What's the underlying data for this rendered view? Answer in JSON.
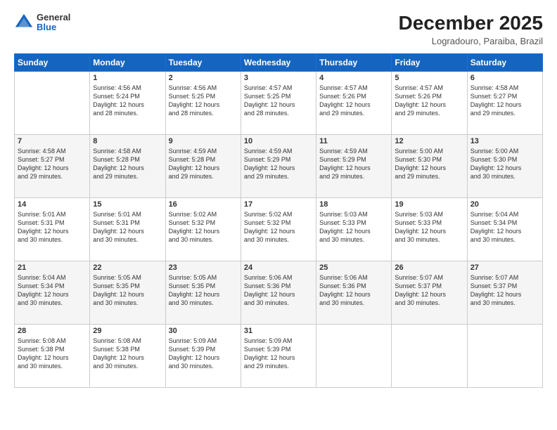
{
  "header": {
    "logo_general": "General",
    "logo_blue": "Blue",
    "month_title": "December 2025",
    "subtitle": "Logradouro, Paraiba, Brazil"
  },
  "days_of_week": [
    "Sunday",
    "Monday",
    "Tuesday",
    "Wednesday",
    "Thursday",
    "Friday",
    "Saturday"
  ],
  "weeks": [
    [
      {
        "day": "",
        "info": ""
      },
      {
        "day": "1",
        "info": "Sunrise: 4:56 AM\nSunset: 5:24 PM\nDaylight: 12 hours\nand 28 minutes."
      },
      {
        "day": "2",
        "info": "Sunrise: 4:56 AM\nSunset: 5:25 PM\nDaylight: 12 hours\nand 28 minutes."
      },
      {
        "day": "3",
        "info": "Sunrise: 4:57 AM\nSunset: 5:25 PM\nDaylight: 12 hours\nand 28 minutes."
      },
      {
        "day": "4",
        "info": "Sunrise: 4:57 AM\nSunset: 5:26 PM\nDaylight: 12 hours\nand 29 minutes."
      },
      {
        "day": "5",
        "info": "Sunrise: 4:57 AM\nSunset: 5:26 PM\nDaylight: 12 hours\nand 29 minutes."
      },
      {
        "day": "6",
        "info": "Sunrise: 4:58 AM\nSunset: 5:27 PM\nDaylight: 12 hours\nand 29 minutes."
      }
    ],
    [
      {
        "day": "7",
        "info": "Sunrise: 4:58 AM\nSunset: 5:27 PM\nDaylight: 12 hours\nand 29 minutes."
      },
      {
        "day": "8",
        "info": "Sunrise: 4:58 AM\nSunset: 5:28 PM\nDaylight: 12 hours\nand 29 minutes."
      },
      {
        "day": "9",
        "info": "Sunrise: 4:59 AM\nSunset: 5:28 PM\nDaylight: 12 hours\nand 29 minutes."
      },
      {
        "day": "10",
        "info": "Sunrise: 4:59 AM\nSunset: 5:29 PM\nDaylight: 12 hours\nand 29 minutes."
      },
      {
        "day": "11",
        "info": "Sunrise: 4:59 AM\nSunset: 5:29 PM\nDaylight: 12 hours\nand 29 minutes."
      },
      {
        "day": "12",
        "info": "Sunrise: 5:00 AM\nSunset: 5:30 PM\nDaylight: 12 hours\nand 29 minutes."
      },
      {
        "day": "13",
        "info": "Sunrise: 5:00 AM\nSunset: 5:30 PM\nDaylight: 12 hours\nand 30 minutes."
      }
    ],
    [
      {
        "day": "14",
        "info": "Sunrise: 5:01 AM\nSunset: 5:31 PM\nDaylight: 12 hours\nand 30 minutes."
      },
      {
        "day": "15",
        "info": "Sunrise: 5:01 AM\nSunset: 5:31 PM\nDaylight: 12 hours\nand 30 minutes."
      },
      {
        "day": "16",
        "info": "Sunrise: 5:02 AM\nSunset: 5:32 PM\nDaylight: 12 hours\nand 30 minutes."
      },
      {
        "day": "17",
        "info": "Sunrise: 5:02 AM\nSunset: 5:32 PM\nDaylight: 12 hours\nand 30 minutes."
      },
      {
        "day": "18",
        "info": "Sunrise: 5:03 AM\nSunset: 5:33 PM\nDaylight: 12 hours\nand 30 minutes."
      },
      {
        "day": "19",
        "info": "Sunrise: 5:03 AM\nSunset: 5:33 PM\nDaylight: 12 hours\nand 30 minutes."
      },
      {
        "day": "20",
        "info": "Sunrise: 5:04 AM\nSunset: 5:34 PM\nDaylight: 12 hours\nand 30 minutes."
      }
    ],
    [
      {
        "day": "21",
        "info": "Sunrise: 5:04 AM\nSunset: 5:34 PM\nDaylight: 12 hours\nand 30 minutes."
      },
      {
        "day": "22",
        "info": "Sunrise: 5:05 AM\nSunset: 5:35 PM\nDaylight: 12 hours\nand 30 minutes."
      },
      {
        "day": "23",
        "info": "Sunrise: 5:05 AM\nSunset: 5:35 PM\nDaylight: 12 hours\nand 30 minutes."
      },
      {
        "day": "24",
        "info": "Sunrise: 5:06 AM\nSunset: 5:36 PM\nDaylight: 12 hours\nand 30 minutes."
      },
      {
        "day": "25",
        "info": "Sunrise: 5:06 AM\nSunset: 5:36 PM\nDaylight: 12 hours\nand 30 minutes."
      },
      {
        "day": "26",
        "info": "Sunrise: 5:07 AM\nSunset: 5:37 PM\nDaylight: 12 hours\nand 30 minutes."
      },
      {
        "day": "27",
        "info": "Sunrise: 5:07 AM\nSunset: 5:37 PM\nDaylight: 12 hours\nand 30 minutes."
      }
    ],
    [
      {
        "day": "28",
        "info": "Sunrise: 5:08 AM\nSunset: 5:38 PM\nDaylight: 12 hours\nand 30 minutes."
      },
      {
        "day": "29",
        "info": "Sunrise: 5:08 AM\nSunset: 5:38 PM\nDaylight: 12 hours\nand 30 minutes."
      },
      {
        "day": "30",
        "info": "Sunrise: 5:09 AM\nSunset: 5:39 PM\nDaylight: 12 hours\nand 30 minutes."
      },
      {
        "day": "31",
        "info": "Sunrise: 5:09 AM\nSunset: 5:39 PM\nDaylight: 12 hours\nand 29 minutes."
      },
      {
        "day": "",
        "info": ""
      },
      {
        "day": "",
        "info": ""
      },
      {
        "day": "",
        "info": ""
      }
    ]
  ]
}
